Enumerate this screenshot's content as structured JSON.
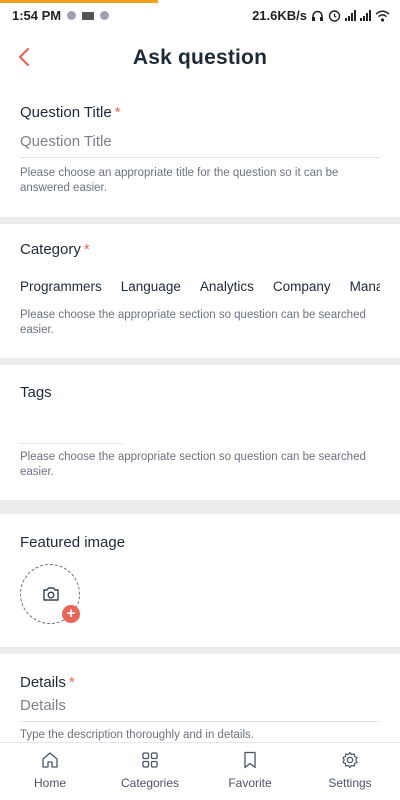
{
  "status_bar": {
    "time": "1:54 PM",
    "net_speed": "21.6KB/s"
  },
  "header": {
    "title": "Ask question"
  },
  "form": {
    "title_field": {
      "label": "Question Title",
      "required_mark": "*",
      "placeholder": "Question Title",
      "help": "Please choose an appropriate title for the question so it can be answered easier."
    },
    "category_field": {
      "label": "Category",
      "required_mark": "*",
      "options": [
        "Programmers",
        "Language",
        "Analytics",
        "Company",
        "Manag"
      ],
      "help": "Please choose the appropriate section so question can be searched easier."
    },
    "tags_field": {
      "label": "Tags",
      "help": "Please choose the appropriate section so question can be searched easier."
    },
    "image_field": {
      "label": "Featured image",
      "badge": "+"
    },
    "details_field": {
      "label": "Details",
      "required_mark": "*",
      "placeholder": "Details",
      "help": "Type the description thoroughly and in details."
    }
  },
  "nav": {
    "items": [
      {
        "label": "Home",
        "icon": "home-icon"
      },
      {
        "label": "Categories",
        "icon": "grid-icon"
      },
      {
        "label": "Favorite",
        "icon": "bookmark-icon"
      },
      {
        "label": "Settings",
        "icon": "gear-icon"
      }
    ]
  },
  "colors": {
    "accent": "#e8675a",
    "status_progress": "#f0a01c",
    "divider": "#ececec"
  }
}
